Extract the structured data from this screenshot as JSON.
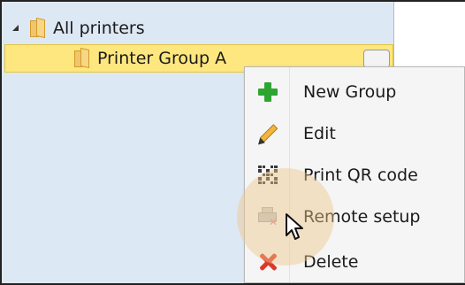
{
  "tree": {
    "root_label": "All printers",
    "child_label": "Printer Group A"
  },
  "context_menu": {
    "items": [
      {
        "label": "New Group",
        "icon": "plus-icon"
      },
      {
        "label": "Edit",
        "icon": "pencil-icon"
      },
      {
        "label": "Print QR code",
        "icon": "qr-code-icon"
      },
      {
        "label": "Remote setup",
        "icon": "remote-printer-icon"
      },
      {
        "label": "Delete",
        "icon": "delete-x-icon"
      }
    ]
  },
  "colors": {
    "tree_background": "#dde8f5",
    "selection_yellow": "#fde77e",
    "plus_green": "#2fa531",
    "delete_red": "#d93a2b"
  }
}
